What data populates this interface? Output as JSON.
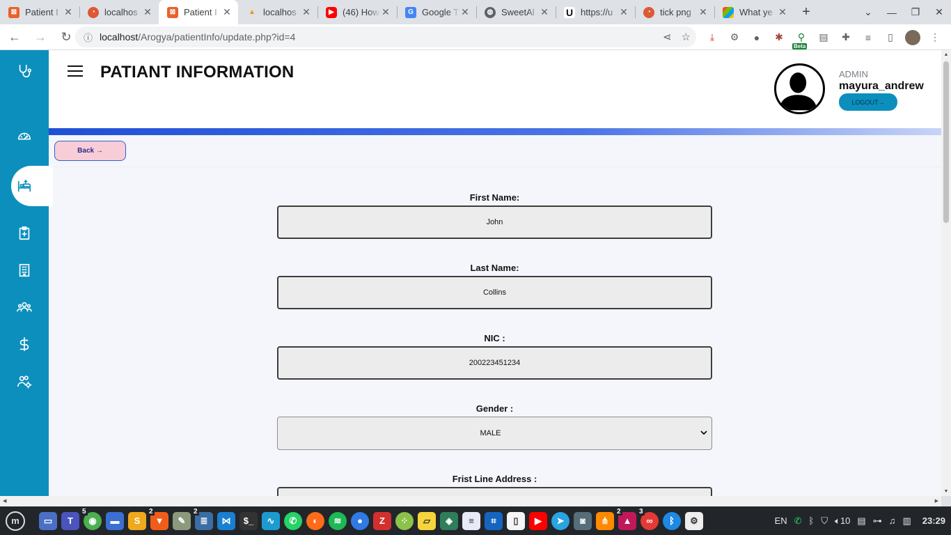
{
  "browser": {
    "tabs": [
      {
        "title": "Patient I",
        "fav_color": "#e8622c",
        "fav": "icon-xampp"
      },
      {
        "title": "localhos",
        "fav_color": "#de5833",
        "fav": "icon-duckduckgo"
      },
      {
        "title": "Patient I",
        "fav_color": "#e8622c",
        "fav": "icon-xampp",
        "active": true
      },
      {
        "title": "localhos",
        "fav_color": "#f29111",
        "fav": "icon-phpmyadmin"
      },
      {
        "title": "(46) How",
        "fav_color": "#ff0000",
        "fav": "icon-youtube"
      },
      {
        "title": "Google T",
        "fav_color": "#4285f4",
        "fav": "icon-google-translate"
      },
      {
        "title": "SweetAl",
        "fav_color": "#5f6368",
        "fav": "icon-globe"
      },
      {
        "title": "https://u",
        "fav_color": "#111111",
        "fav": "icon-u"
      },
      {
        "title": "tick png",
        "fav_color": "#de5833",
        "fav": "icon-duckduckgo"
      },
      {
        "title": "What ye",
        "fav_color": "#f4b400",
        "fav": "icon-windows"
      }
    ],
    "new_tab": "+",
    "url_host": "localhost",
    "url_path": "/Arogya/patientInfo/update.php?id=4",
    "extension_badge": "Beta"
  },
  "header": {
    "title": "PATIANT INFORMATION",
    "role": "ADMIN",
    "username": "mayura_andrew",
    "logout_label": "LOGOUT→"
  },
  "sidebar": {
    "items": [
      {
        "name": "stethoscope-icon"
      },
      {
        "name": "dashboard-gauge-icon"
      },
      {
        "name": "patient-bed-icon",
        "active": true
      },
      {
        "name": "clipboard-plus-icon"
      },
      {
        "name": "hospital-building-icon"
      },
      {
        "name": "staff-group-icon"
      },
      {
        "name": "dollar-icon"
      },
      {
        "name": "user-settings-icon"
      }
    ],
    "color": "#0c8fbd"
  },
  "back_label": "Back →",
  "form": {
    "first_name": {
      "label": "First Name:",
      "value": "John"
    },
    "last_name": {
      "label": "Last Name:",
      "value": "Collins"
    },
    "nic": {
      "label": "NIC :",
      "value": "200223451234"
    },
    "gender": {
      "label": "Gender :",
      "value": "MALE"
    },
    "address1": {
      "label": "Frist Line Address :",
      "value": ""
    }
  },
  "taskbar": {
    "badges": {
      "chrome": "5",
      "brave": "2",
      "files": "2",
      "photos": "2",
      "glasses": "3"
    },
    "lang": "EN",
    "volume": "10",
    "clock": "23:29"
  }
}
